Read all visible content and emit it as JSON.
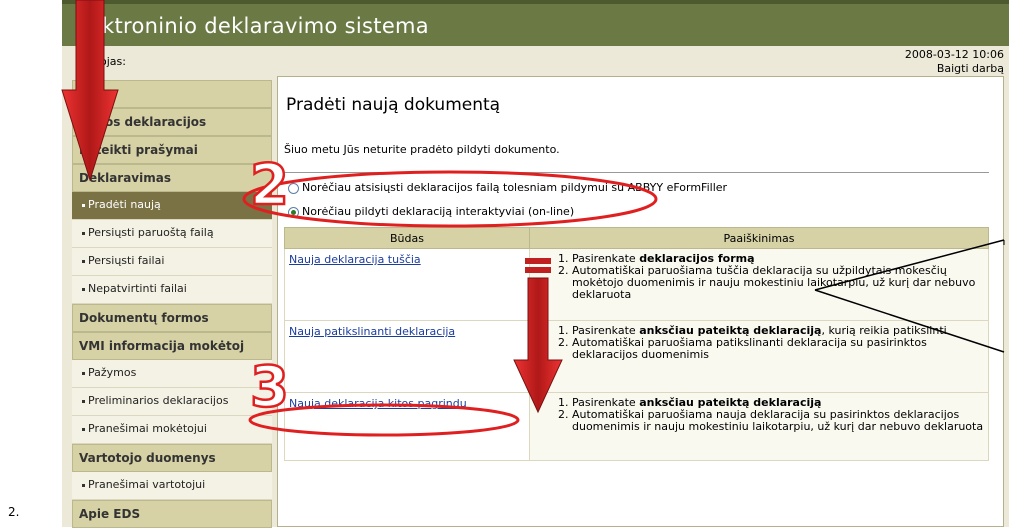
{
  "header": {
    "title": "ktroninio deklaravimo sistema",
    "sub_left": "ojas:",
    "date": "2008-03-12 10:06",
    "end_link": "Baigti darbą"
  },
  "sidebar": {
    "items": [
      {
        "label": "ia",
        "kind": "head"
      },
      {
        "label": "eiktos deklaracijos",
        "kind": "head"
      },
      {
        "label": "Pateikti prašymai",
        "kind": "head"
      },
      {
        "label": "Deklaravimas",
        "kind": "head"
      },
      {
        "label": "Pradėti naują",
        "kind": "sub",
        "active": true
      },
      {
        "label": "Persiųsti paruoštą failą",
        "kind": "sub"
      },
      {
        "label": "Persiųsti failai",
        "kind": "sub"
      },
      {
        "label": "Nepatvirtinti failai",
        "kind": "sub"
      },
      {
        "label": "Dokumentų formos",
        "kind": "head"
      },
      {
        "label": "VMI informacija mokėtoj",
        "kind": "head"
      },
      {
        "label": "Pažymos",
        "kind": "sub"
      },
      {
        "label": "Preliminarios deklaracijos",
        "kind": "sub"
      },
      {
        "label": "Pranešimai mokėtojui",
        "kind": "sub"
      },
      {
        "label": "Vartotojo duomenys",
        "kind": "head"
      },
      {
        "label": "Pranešimai vartotojui",
        "kind": "sub"
      },
      {
        "label": "Apie EDS",
        "kind": "head"
      }
    ]
  },
  "main": {
    "title": "Pradėti naują dokumentą",
    "message": "Šiuo metu Jūs neturite pradėto pildyti dokumento.",
    "option1": "Norėčiau atsisiųsti deklaracijos failą tolesniam pildymui su ABBYY eFormFiller",
    "option2": "Norėčiau pildyti deklaraciją interaktyviai (on-line)",
    "table": {
      "headers": [
        "Būdas",
        "Paaiškinimas"
      ],
      "rows": [
        {
          "link": "Nauja deklaracija tuščia",
          "steps": [
            {
              "pre": "Pasirenkate ",
              "bold": "deklaracijos formą",
              "post": ""
            },
            {
              "pre": "Automatiškai paruošiama tuščia deklaracija su užpildytais mokesčių mokėtojo duomenimis ir nauju mokestiniu laikotarpiu, už kurį dar nebuvo deklaruota",
              "bold": "",
              "post": ""
            }
          ]
        },
        {
          "link": "Nauja patikslinanti deklaracija",
          "steps": [
            {
              "pre": "Pasirenkate ",
              "bold": "anksčiau pateiktą deklaraciją",
              "post": ", kurią reikia patikslinti"
            },
            {
              "pre": "Automatiškai paruošiama patikslinanti deklaracija su pasirinktos deklaracijos duomenimis",
              "bold": "",
              "post": ""
            }
          ]
        },
        {
          "link": "Nauja deklaracija kitos pagrindu",
          "steps": [
            {
              "pre": "Pasirenkate ",
              "bold": "anksčiau pateiktą deklaraciją",
              "post": ""
            },
            {
              "pre": "Automatiškai paruošiama nauja deklaracija su pasirinktos deklaracijos duomenimis ir nauju mokestiniu laikotarpiu, už kurį dar nebuvo deklaruota",
              "bold": "",
              "post": ""
            }
          ]
        }
      ]
    }
  },
  "annotations": {
    "num2": "2",
    "num3": "3",
    "footnote": "2.",
    "color": "#e02020"
  }
}
